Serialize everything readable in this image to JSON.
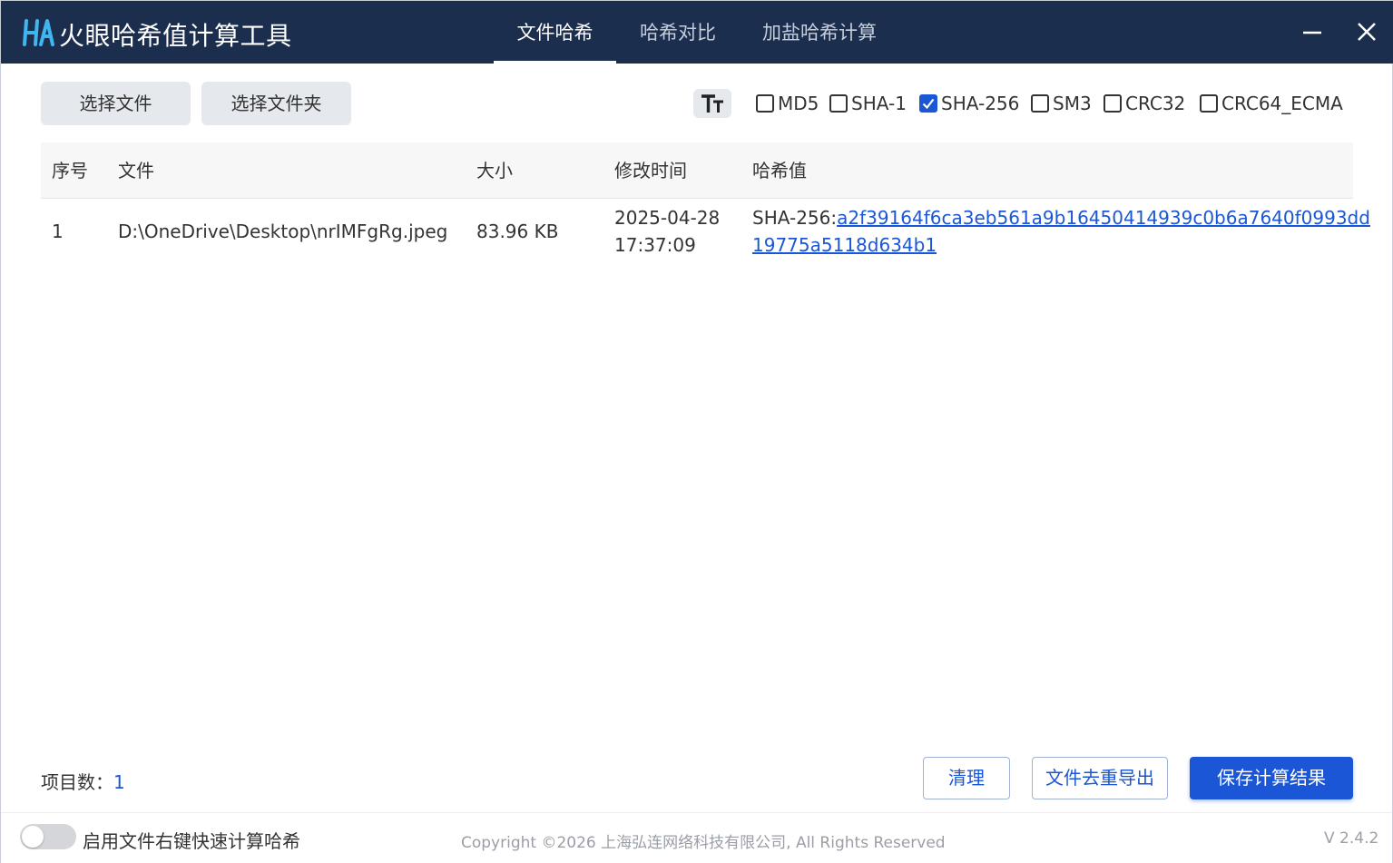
{
  "titlebar": {
    "logo_text": "HA",
    "app_title": "火眼哈希值计算工具",
    "tabs": [
      {
        "label": "文件哈希",
        "active": true
      },
      {
        "label": "哈希对比",
        "active": false
      },
      {
        "label": "加盐哈希计算",
        "active": false
      }
    ],
    "minimize_icon": "minimize-icon",
    "close_icon": "close-icon"
  },
  "toolbar": {
    "select_file_label": "选择文件",
    "select_folder_label": "选择文件夹",
    "font_size_icon": "text-size-icon",
    "algorithms": [
      {
        "label": "MD5",
        "checked": false
      },
      {
        "label": "SHA-1",
        "checked": false
      },
      {
        "label": "SHA-256",
        "checked": true
      },
      {
        "label": "SM3",
        "checked": false
      },
      {
        "label": "CRC32",
        "checked": false
      },
      {
        "label": "CRC64_ECMA",
        "checked": false
      }
    ]
  },
  "table": {
    "headers": {
      "index": "序号",
      "file": "文件",
      "size": "大小",
      "modified": "修改时间",
      "hash": "哈希值"
    },
    "rows": [
      {
        "index": "1",
        "file": "D:\\OneDrive\\Desktop\\nrIMFgRg.jpeg",
        "size": "83.96 KB",
        "modified_date": "2025-04-28",
        "modified_time": "17:37:09",
        "hash_prefix": "SHA-256:",
        "hash_line1": "a2f39164f6ca3eb561a9b16450414939c0b6a7640f0993dd",
        "hash_line2": "19775a5118d634b1"
      }
    ]
  },
  "footer": {
    "count_label": "项目数：",
    "count_value": "1",
    "clear_label": "清理",
    "dedupe_export_label": "文件去重导出",
    "save_label": "保存计算结果"
  },
  "statusbar": {
    "toggle_label": "启用文件右键快速计算哈希",
    "toggle_on": false,
    "copyright": "Copyright ©2026 上海弘连网络科技有限公司, All Rights Reserved",
    "version": "V 2.4.2"
  },
  "colors": {
    "titlebar_bg": "#1c2e4e",
    "accent": "#1a56d6",
    "button_gray": "#e5e8ec"
  }
}
